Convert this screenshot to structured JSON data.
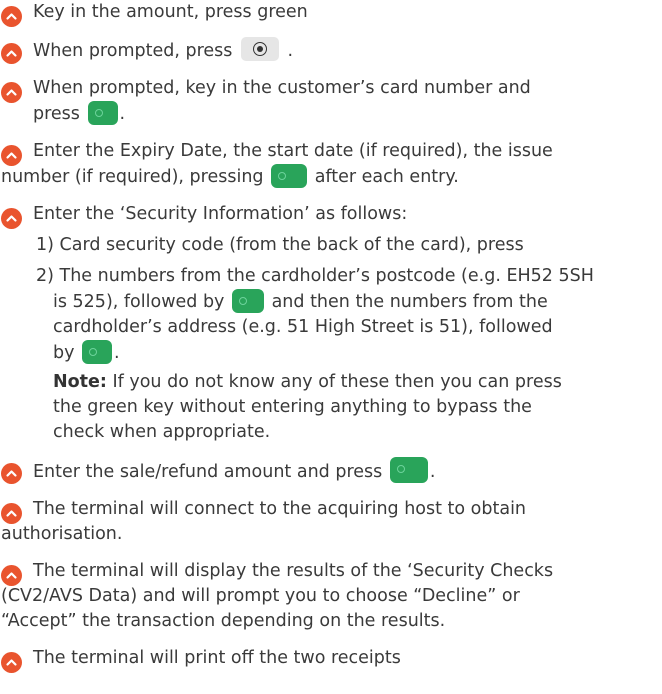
{
  "colors": {
    "bullet": "#e9542e",
    "green_key": "#29a45a",
    "grey_key": "#e6e6e6",
    "text": "#3a3a3a"
  },
  "icons": {
    "bullet": "chevron-up-icon",
    "select_key": "select-button-icon",
    "green_key": "green-enter-key-icon"
  },
  "steps": {
    "s1": "Key in the amount, press green",
    "s2a": "When prompted, press",
    "s2b": ".",
    "s3a": "When prompted, key in the customer’s card number and",
    "s3b": "press",
    "s3c": ".",
    "s4a": "Enter the Expiry Date, the start date (if required), the issue",
    "s4b": "number (if required), pressing",
    "s4c": "after each entry.",
    "s5": "Enter the ‘Security Information’ as follows:",
    "s6a": "Enter the sale/refund amount and press",
    "s6b": ".",
    "s7a": "The terminal will connect to the acquiring host to obtain",
    "s7b": "authorisation.",
    "s8a": "The terminal will display the results of the ‘Security Checks",
    "s8b": "(CV2/AVS Data) and will prompt you to choose “Decline” or",
    "s8c": "“Accept” the transaction depending on the results.",
    "s9": "The terminal will print off the two receipts"
  },
  "sub": {
    "i1": "1) Card security code (from the back of the card), press",
    "i2a": "2) The numbers from the cardholder’s postcode (e.g. EH52 5SH",
    "i2b": "is 525), followed by",
    "i2c": "and then the numbers from the",
    "i2d": "cardholder’s address (e.g. 51 High Street is 51), followed",
    "i2e": "by",
    "i2f": ".",
    "note_label": "Note:",
    "note_a": "If you do not know any of these then you can press",
    "note_b": "the green key without entering anything to bypass the",
    "note_c": "check when appropriate."
  }
}
